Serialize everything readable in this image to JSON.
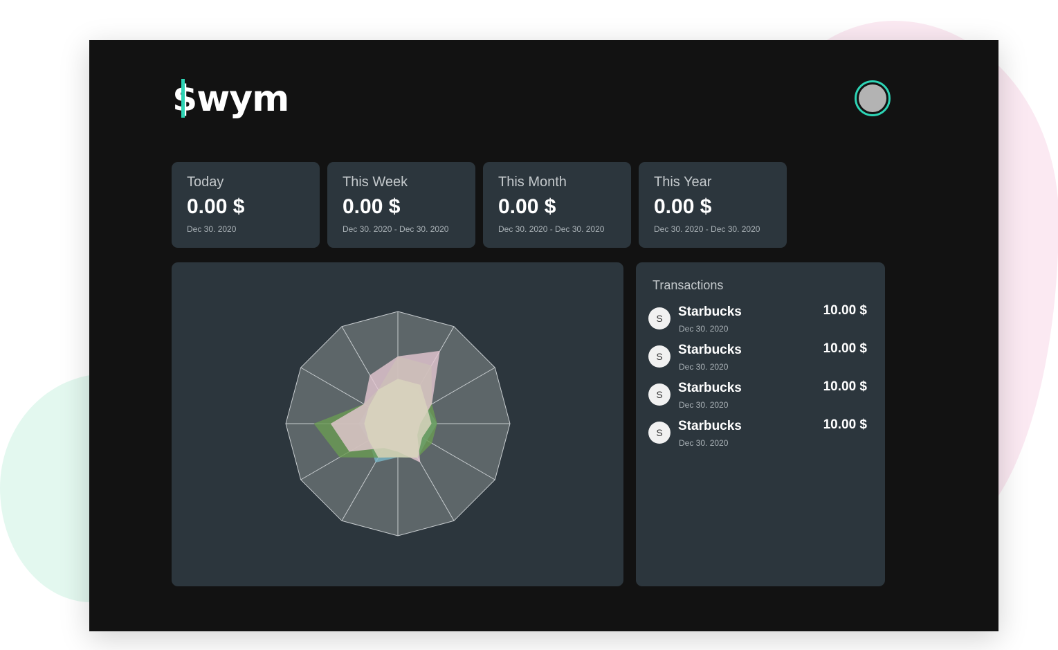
{
  "app": {
    "logo_text": "$wym",
    "logo_dollar": "$",
    "logo_rest": "wym",
    "accent_color": "#2dd4b5"
  },
  "stats": [
    {
      "label": "Today",
      "value": "0.00 $",
      "date": "Dec 30. 2020"
    },
    {
      "label": "This Week",
      "value": "0.00 $",
      "date": "Dec 30. 2020 - Dec 30. 2020"
    },
    {
      "label": "This Month",
      "value": "0.00 $",
      "date": "Dec 30. 2020 - Dec 30. 2020"
    },
    {
      "label": "This Year",
      "value": "0.00 $",
      "date": "Dec 30. 2020 - Dec 30. 2020"
    }
  ],
  "transactions": {
    "title": "Transactions",
    "items": [
      {
        "icon_letter": "S",
        "name": "Starbucks",
        "date": "Dec 30. 2020",
        "amount": "10.00 $"
      },
      {
        "icon_letter": "S",
        "name": "Starbucks",
        "date": "Dec 30. 2020",
        "amount": "10.00 $"
      },
      {
        "icon_letter": "S",
        "name": "Starbucks",
        "date": "Dec 30. 2020",
        "amount": "10.00 $"
      },
      {
        "icon_letter": "S",
        "name": "Starbucks",
        "date": "Dec 30. 2020",
        "amount": "10.00 $"
      }
    ]
  },
  "chart_data": {
    "type": "radar",
    "axes_count": 12,
    "range": [
      0,
      1
    ],
    "series": [
      {
        "color": "#7ab8c8",
        "values": [
          0.4,
          0.35,
          0.3,
          0.35,
          0.3,
          0.35,
          0.3,
          0.4,
          0.3,
          0.35,
          0.3,
          0.35
        ]
      },
      {
        "color": "#6a9b52",
        "values": [
          0.6,
          0.6,
          0.35,
          0.35,
          0.35,
          0.35,
          0.3,
          0.35,
          0.6,
          0.75,
          0.35,
          0.35
        ]
      },
      {
        "color": "#e6c8d2",
        "values": [
          0.6,
          0.75,
          0.35,
          0.2,
          0.2,
          0.4,
          0.25,
          0.25,
          0.5,
          0.6,
          0.35,
          0.5
        ]
      },
      {
        "color": "#d8d3bd",
        "values": [
          0.4,
          0.4,
          0.3,
          0.3,
          0.25,
          0.35,
          0.3,
          0.35,
          0.3,
          0.3,
          0.3,
          0.35
        ]
      }
    ]
  }
}
